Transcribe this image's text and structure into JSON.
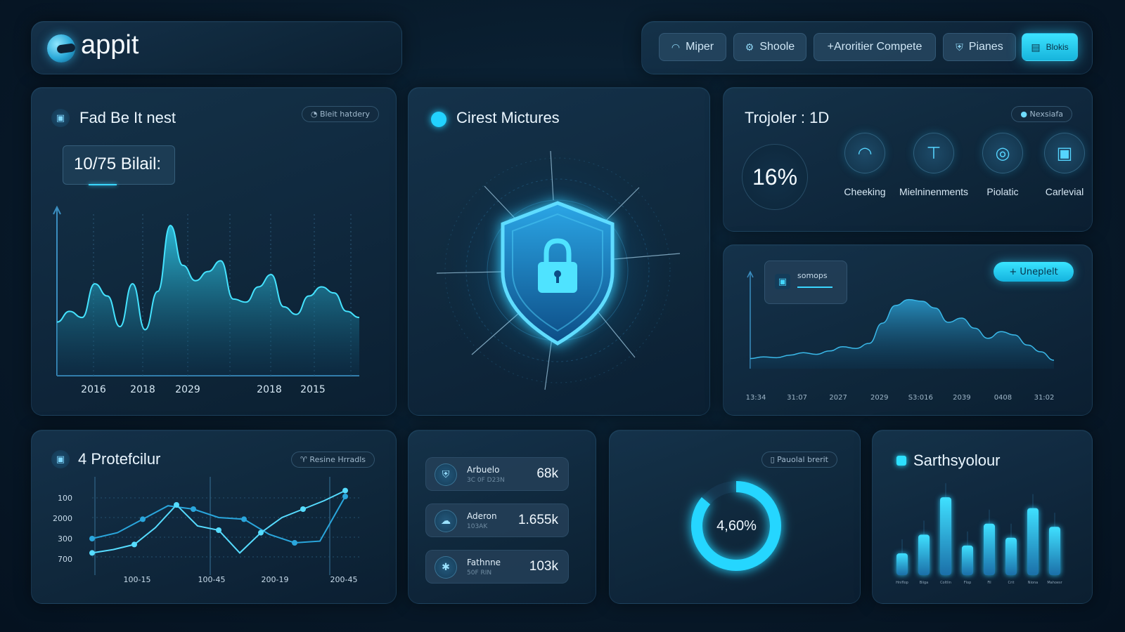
{
  "app": {
    "name": "appit"
  },
  "nav": [
    {
      "label": "Miper",
      "icon": "wifi-icon"
    },
    {
      "label": "Shoole",
      "icon": "gear-icon"
    },
    {
      "label": "+Aroritier Compete",
      "icon": ""
    },
    {
      "label": "Pianes",
      "icon": "shield-icon"
    },
    {
      "label": "Blokis",
      "icon": "card-icon",
      "active": true
    }
  ],
  "panel_main_chart": {
    "title": "Fad Be It nest",
    "pill": "Bleit hatdery",
    "kpi": "10/75 Bilail:",
    "chart_data": {
      "type": "area",
      "x_labels": [
        "2016",
        "2018",
        "2029",
        "2018",
        "2015"
      ],
      "values": [
        35,
        42,
        38,
        60,
        52,
        32,
        60,
        30,
        55,
        98,
        72,
        62,
        68,
        75,
        50,
        48,
        58,
        66,
        45,
        40,
        52,
        58,
        54,
        42,
        38
      ],
      "ylim": [
        0,
        110
      ],
      "color": "#2fd0ef"
    }
  },
  "panel_security": {
    "title": "Cirest Mictures",
    "icon": "lock-icon"
  },
  "panel_features": {
    "title": "Trojoler : 1D",
    "pill": "Nexsiafa",
    "percent": "16%",
    "items": [
      {
        "label": "Cheeking",
        "icon": "wifi-icon"
      },
      {
        "label": "Mielninenments",
        "icon": "tool-icon"
      },
      {
        "label": "Piolatic",
        "icon": "radar-icon"
      },
      {
        "label": "Carlevial",
        "icon": "device-icon"
      }
    ]
  },
  "panel_area": {
    "card_label": "somops",
    "button": "+ Uneplelt",
    "chart_data": {
      "type": "area",
      "x_labels": [
        "13:34",
        "31:07",
        "2027",
        "2029",
        "S3:016",
        "2039",
        "0408",
        "31:02"
      ],
      "values": [
        12,
        14,
        13,
        16,
        19,
        17,
        21,
        26,
        24,
        30,
        54,
        75,
        82,
        80,
        72,
        55,
        60,
        48,
        36,
        44,
        40,
        28,
        20,
        10
      ],
      "ylim": [
        0,
        100
      ],
      "color": "#2b9fd3"
    }
  },
  "panel_lines": {
    "title": "4 Protefcilur",
    "pill": "Resine Hrradls",
    "y_labels": [
      "100",
      "2000",
      "300",
      "700"
    ],
    "x_labels": [
      "100-15",
      "100-45",
      "200-19",
      "200-45"
    ],
    "chart_data": {
      "type": "line",
      "series": [
        {
          "values": [
            35,
            42,
            58,
            74,
            70,
            60,
            58,
            40,
            30,
            32,
            85
          ]
        },
        {
          "values": [
            18,
            22,
            28,
            48,
            75,
            50,
            45,
            18,
            42,
            60,
            70,
            80,
            92
          ]
        }
      ],
      "ylim": [
        0,
        100
      ]
    }
  },
  "panel_stats": {
    "rows": [
      {
        "name": "Arbuelo",
        "sub": "3C 0F D23N",
        "value": "68k",
        "icon": "shield-icon"
      },
      {
        "name": "Aderon",
        "sub": "103AK",
        "value": "1.655k",
        "icon": "cloud-icon"
      },
      {
        "name": "Fathnne",
        "sub": "50F RIN",
        "value": "103k",
        "icon": "network-icon"
      }
    ]
  },
  "panel_donut": {
    "pill": "Pauolal brerit",
    "label": "4,60%",
    "chart_data": {
      "type": "pie",
      "values": [
        86,
        14
      ],
      "color": "#25d6ff"
    }
  },
  "panel_bars": {
    "title": "Sarthsyolour",
    "chart_data": {
      "type": "bar",
      "categories": [
        "Hniflop",
        "Biiga",
        "Coltlin",
        "Flop",
        "Fil",
        "Crit",
        "Niona",
        "Mahoesr"
      ],
      "values": [
        28,
        52,
        100,
        38,
        66,
        48,
        86,
        62
      ],
      "ylim": [
        0,
        110
      ],
      "color": "#2bbfec"
    }
  }
}
